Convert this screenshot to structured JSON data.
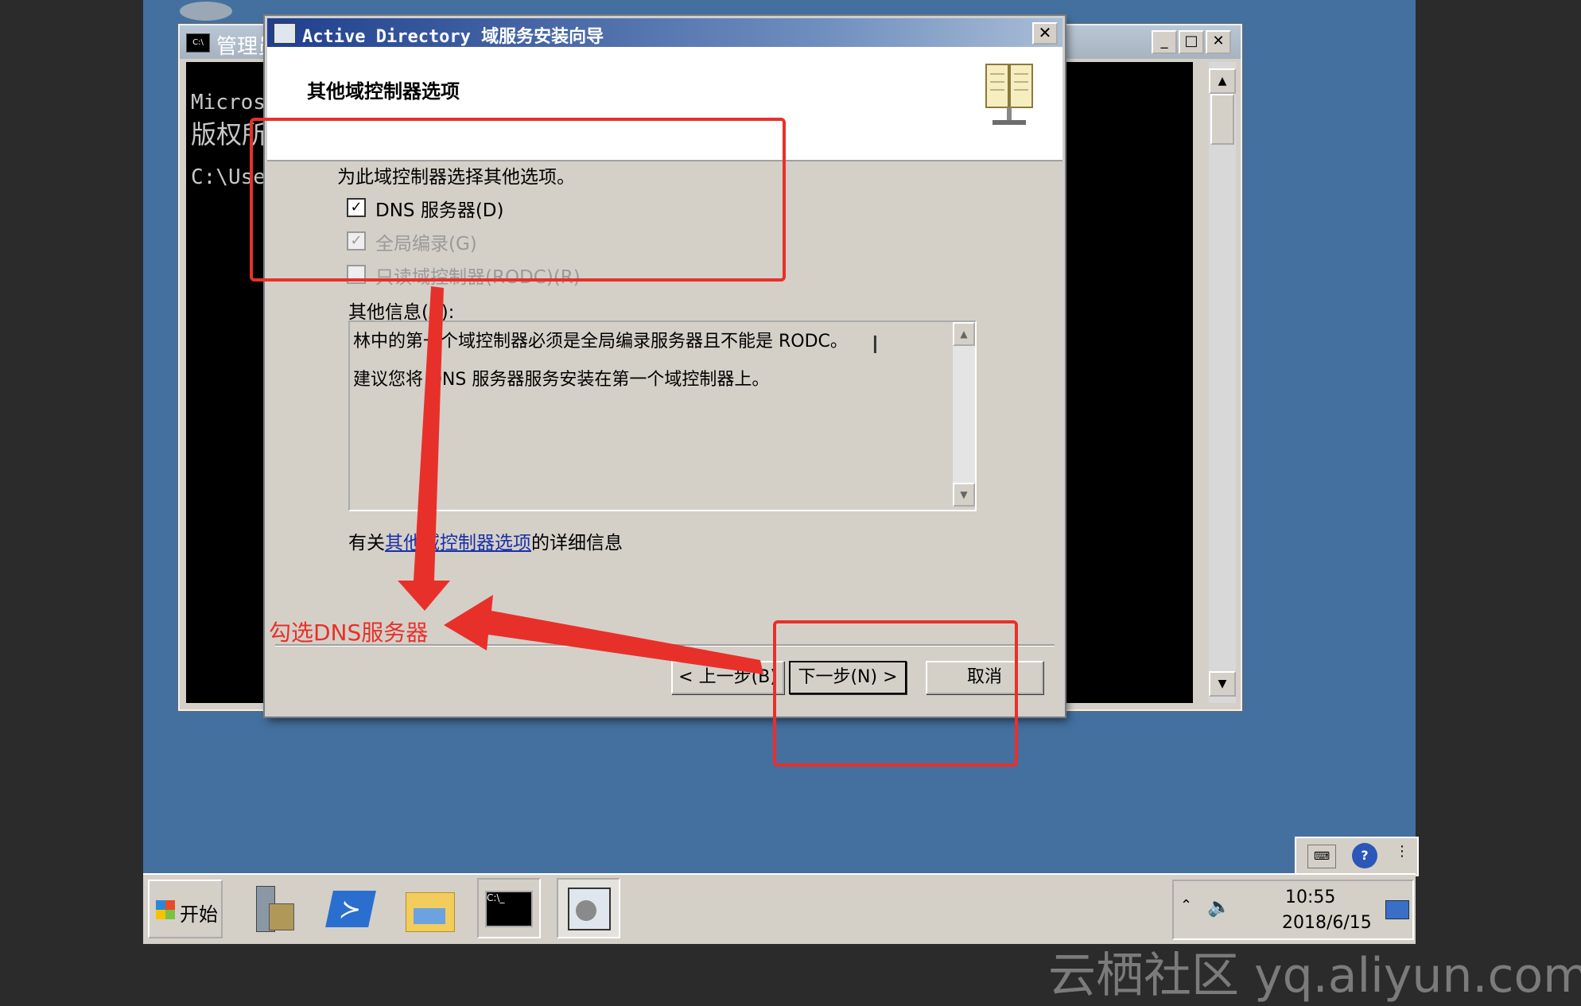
{
  "console": {
    "title": "管理员",
    "icon": "console-icon",
    "lines": [
      "Micros",
      "版权所",
      "C:\\Use"
    ]
  },
  "wizard": {
    "title": "Active Directory 域服务安装向导",
    "close_label": "✕",
    "heading": "其他域控制器选项",
    "instruction": "为此域控制器选择其他选项。",
    "options": [
      {
        "label": "DNS 服务器(D)",
        "checked": true,
        "enabled": true
      },
      {
        "label": "全局编录(G)",
        "checked": true,
        "enabled": false
      },
      {
        "label": "只读域控制器(RODC)(R)",
        "checked": false,
        "enabled": false
      }
    ],
    "info_label": "其他信息(A):",
    "info_lines": [
      "林中的第一个域控制器必须是全局编录服务器且不能是 RODC。",
      "建议您将 DNS 服务器服务安装在第一个域控制器上。"
    ],
    "help_prefix": "有关",
    "help_link": "其他域控制器选项",
    "help_suffix": "的详细信息",
    "buttons": {
      "back": "< 上一步(B)",
      "next": "下一步(N) >",
      "cancel": "取消"
    }
  },
  "taskbar": {
    "start_label": "开始",
    "items": [
      "server-manager-icon",
      "powershell-icon",
      "explorer-icon",
      "cmd-icon",
      "ad-wizard-icon"
    ],
    "clock_time": "10:55",
    "clock_date": "2018/6/15"
  },
  "annotation": {
    "text": "勾选DNS服务器",
    "color": "#e8302a"
  },
  "watermark": "云栖社区 yq.aliyun.com",
  "colors": {
    "desktop": "#43709f",
    "titlebar": "#1f3f8e",
    "link": "#1a2fa8"
  }
}
